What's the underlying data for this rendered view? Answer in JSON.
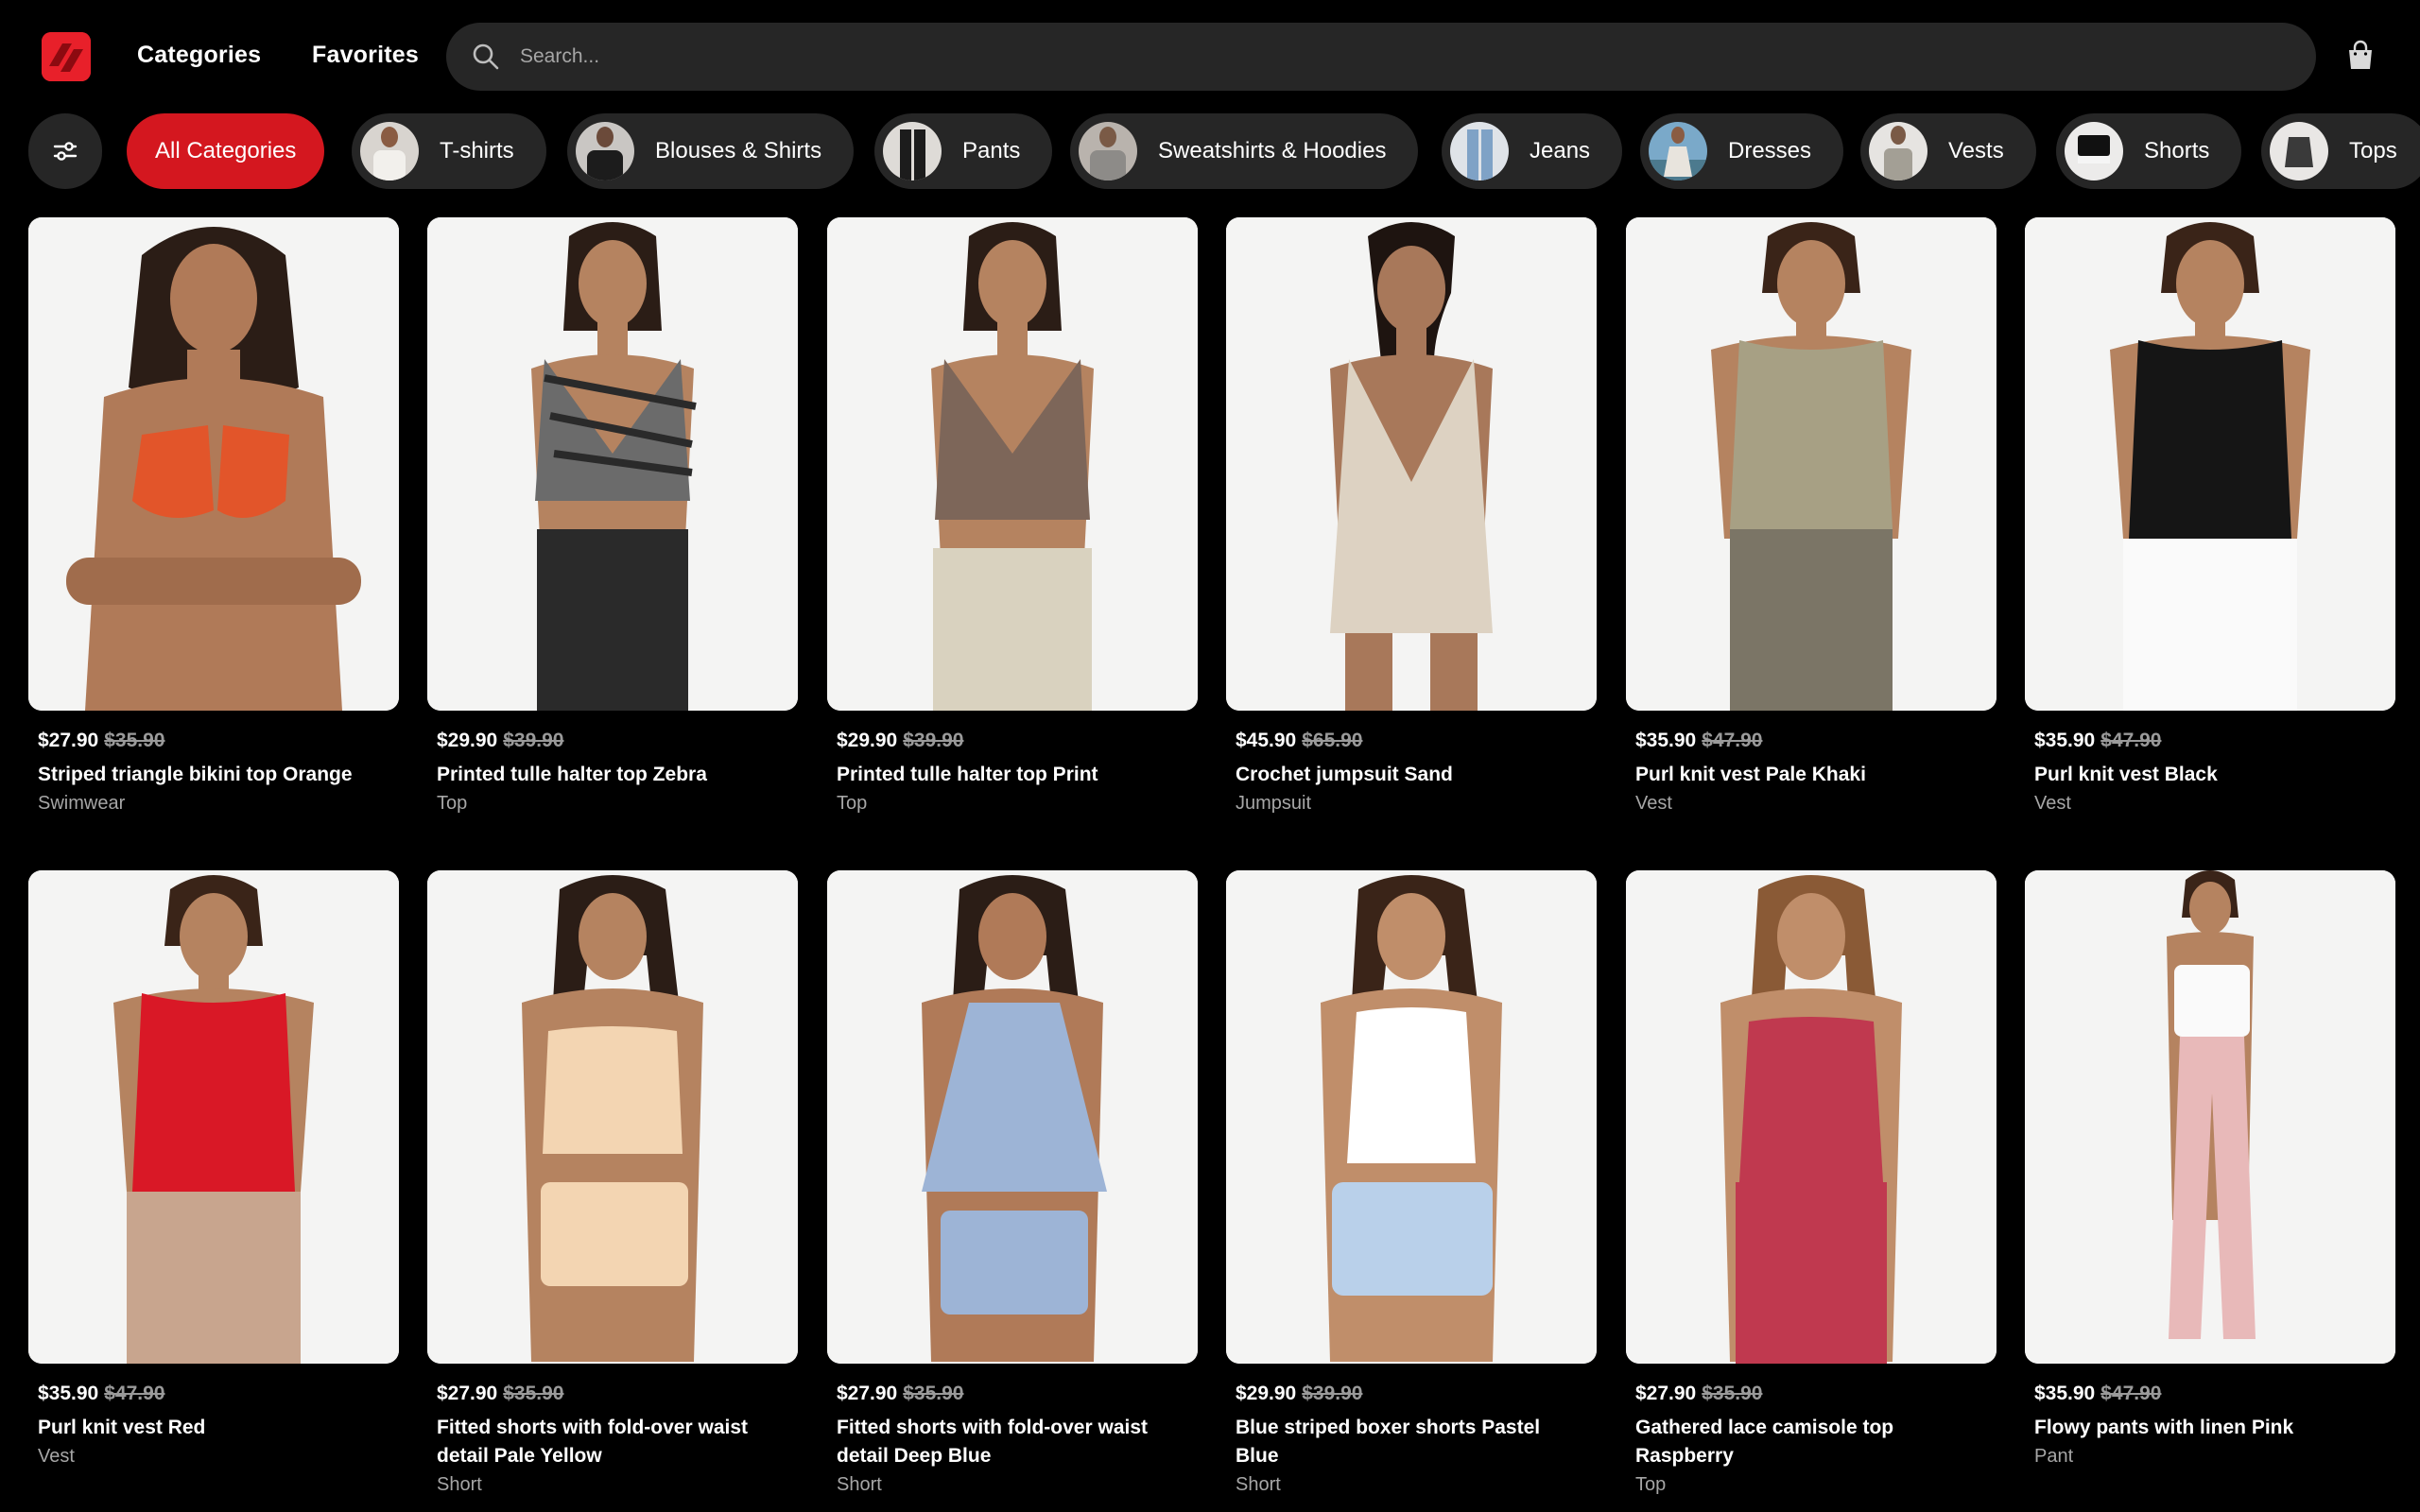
{
  "header": {
    "nav": [
      "Categories",
      "Favorites"
    ],
    "search_placeholder": "Search...",
    "brand_color": "#e8202a"
  },
  "filters": {
    "icon": "sliders-icon",
    "active_color": "#d4171f",
    "chips": [
      {
        "label": "All Categories",
        "active": true
      },
      {
        "label": "T-shirts"
      },
      {
        "label": "Blouses & Shirts"
      },
      {
        "label": "Pants"
      },
      {
        "label": "Sweatshirts & Hoodies"
      },
      {
        "label": "Jeans"
      },
      {
        "label": "Dresses"
      },
      {
        "label": "Vests"
      },
      {
        "label": "Shorts"
      },
      {
        "label": "Tops"
      }
    ]
  },
  "products": [
    {
      "price": "$27.90",
      "old_price": "$35.90",
      "title": "Striped triangle bikini top Orange",
      "category": "Swimwear",
      "garment": "#e2552a"
    },
    {
      "price": "$29.90",
      "old_price": "$39.90",
      "title": "Printed tulle halter top Zebra",
      "category": "Top",
      "garment": "#6b6b6b"
    },
    {
      "price": "$29.90",
      "old_price": "$39.90",
      "title": "Printed tulle halter top Print",
      "category": "Top",
      "garment": "#7d6659"
    },
    {
      "price": "$45.90",
      "old_price": "$65.90",
      "title": "Crochet jumpsuit Sand",
      "category": "Jumpsuit",
      "garment": "#ddd2c2"
    },
    {
      "price": "$35.90",
      "old_price": "$47.90",
      "title": "Purl knit vest Pale Khaki",
      "category": "Vest",
      "garment": "#a7a084"
    },
    {
      "price": "$35.90",
      "old_price": "$47.90",
      "title": "Purl knit vest Black",
      "category": "Vest",
      "garment": "#151515"
    },
    {
      "price": "$35.90",
      "old_price": "$47.90",
      "title": "Purl knit vest Red",
      "category": "Vest",
      "garment": "#d91826"
    },
    {
      "price": "$27.90",
      "old_price": "$35.90",
      "title": "Fitted shorts with fold-over waist detail Pale Yellow",
      "category": "Short",
      "garment": "#f3d5b2"
    },
    {
      "price": "$27.90",
      "old_price": "$35.90",
      "title": "Fitted shorts with fold-over waist detail Deep Blue",
      "category": "Short",
      "garment": "#9db4d6"
    },
    {
      "price": "$29.90",
      "old_price": "$39.90",
      "title": "Blue striped boxer shorts Pastel Blue",
      "category": "Short",
      "garment": "#b9d0ea"
    },
    {
      "price": "$27.90",
      "old_price": "$35.90",
      "title": "Gathered lace camisole top Raspberry",
      "category": "Top",
      "garment": "#c0394f"
    },
    {
      "price": "$35.90",
      "old_price": "$47.90",
      "title": "Flowy pants with linen Pink",
      "category": "Pant",
      "garment": "#e8b9b9"
    }
  ]
}
